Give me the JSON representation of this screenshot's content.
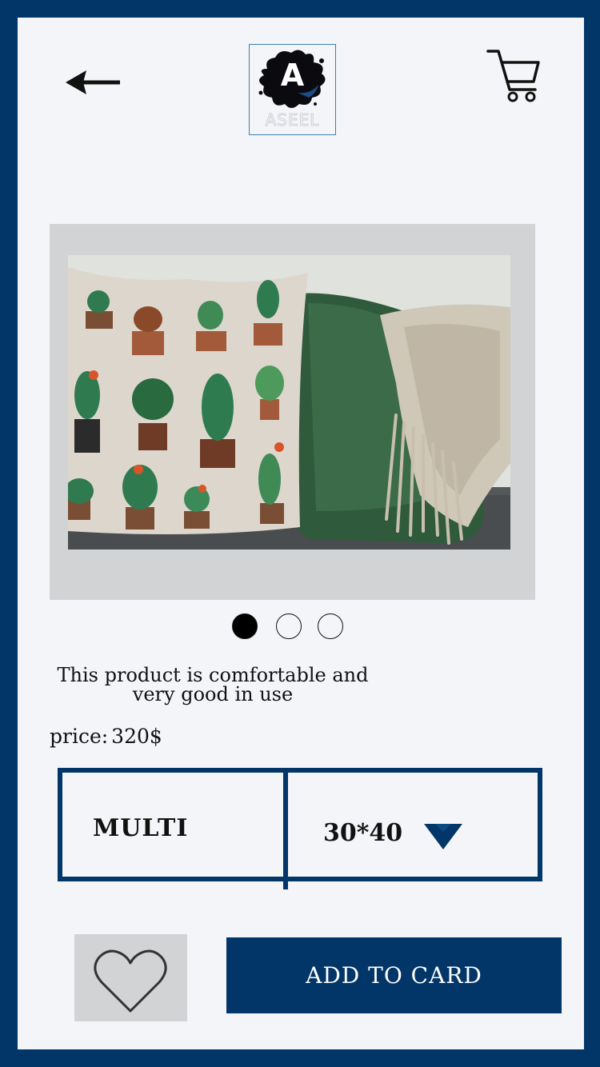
{
  "header": {
    "back_icon": "left-arrow-icon",
    "logo": {
      "letter": "A",
      "word": "ASEEL"
    },
    "cart_icon": "shopping-cart-icon"
  },
  "gallery": {
    "image_alt": "cactus print pillow",
    "dots": [
      {
        "active": true
      },
      {
        "active": false
      },
      {
        "active": false
      }
    ]
  },
  "product": {
    "description_line1": "This product is comfortable and",
    "description_line2": "very good in use",
    "price_label": "price:",
    "price_value": "320$"
  },
  "options": {
    "color_value": "MULTI",
    "size_value": "30*40",
    "size_dropdown_icon": "triangle-down-icon"
  },
  "actions": {
    "favorite_icon": "heart-icon",
    "add_to_cart_label": "ADD TO CARD"
  },
  "colors": {
    "brand": "#033668",
    "background": "#f3f5f8",
    "panel": "#d2d3d5"
  }
}
